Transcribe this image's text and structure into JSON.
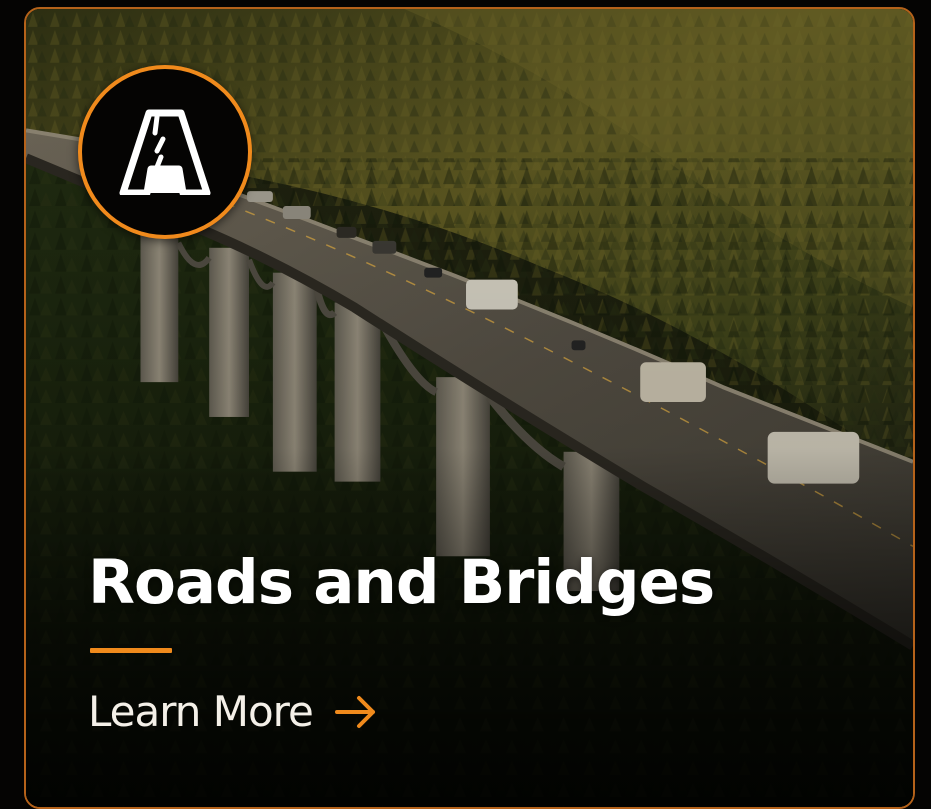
{
  "card": {
    "title": "Roads and Bridges",
    "cta_label": "Learn More",
    "badge_icon": "road-icon",
    "cta_icon": "arrow-right-icon"
  },
  "colors": {
    "accent": "#f08a1c",
    "title": "#ffffff",
    "background": "#050403"
  }
}
